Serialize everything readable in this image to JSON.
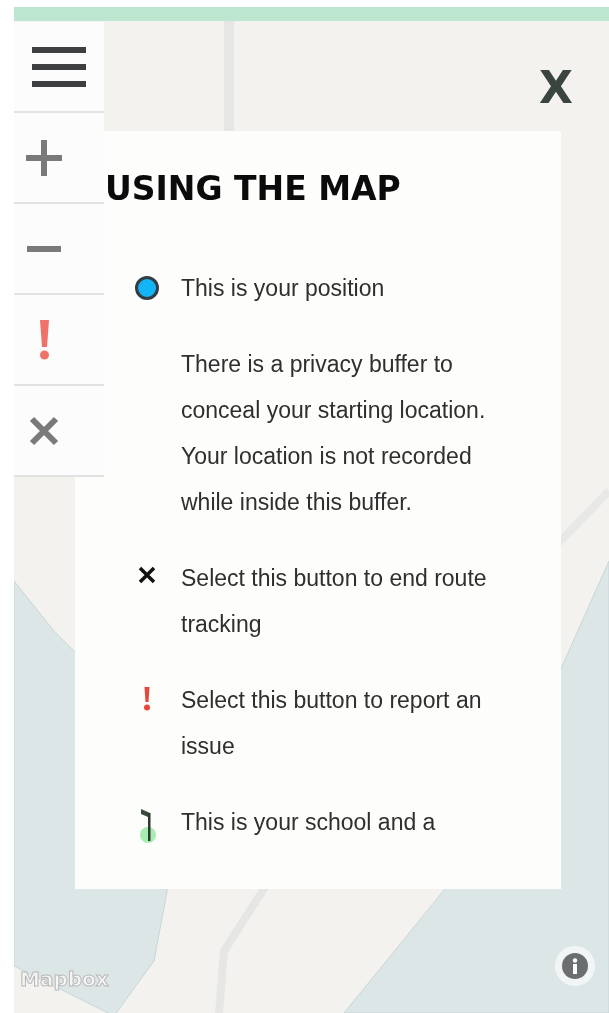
{
  "map": {
    "attribution_logo": "Mapbox"
  },
  "controls": [
    {
      "kind": "menu"
    },
    {
      "kind": "zoom_in"
    },
    {
      "kind": "zoom_out"
    },
    {
      "kind": "report"
    },
    {
      "kind": "end"
    }
  ],
  "close_label": "X",
  "help_panel": {
    "title": "USING THE MAP",
    "items": [
      {
        "kind": "position",
        "text": "This is your position"
      },
      {
        "kind": "note",
        "text": "There is a privacy buffer to conceal your starting location. Your location is not recorded while inside this buffer."
      },
      {
        "kind": "end",
        "text": "Select this button to end route tracking"
      },
      {
        "kind": "report",
        "text": "Select this button to report an issue"
      },
      {
        "kind": "school",
        "text": "This is your school and a"
      }
    ]
  }
}
